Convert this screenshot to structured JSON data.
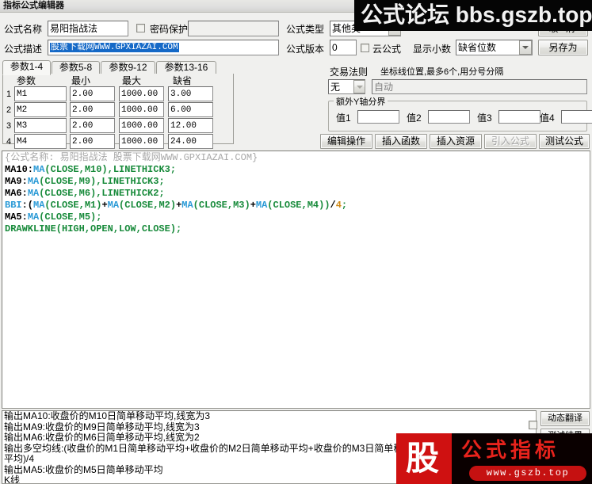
{
  "window": {
    "title": "指标公式编辑器"
  },
  "form": {
    "name_label": "公式名称",
    "name_value": "易阳指战法",
    "password_protect_label": "密码保护",
    "password_value": "",
    "desc_label": "公式描述",
    "desc_value": "股票下载网WWW.GPXIAZAI.COM",
    "type_label": "公式类型",
    "type_value": "其他类",
    "version_label": "公式版本",
    "version_value": "0",
    "cloud_label": "云公式",
    "decimal_label": "显示小数",
    "decimal_value": "缺省位数"
  },
  "buttons": {
    "cancel": "取 消",
    "save_as": "另存为",
    "edit_ops": "编辑操作",
    "insert_function": "插入函数",
    "insert_resource": "插入资源",
    "import_formula": "引入公式",
    "test_formula": "测试公式",
    "dynamic_translate": "动态翻译",
    "test_result": "测试结果"
  },
  "tabs": [
    {
      "label": "参数1-4",
      "active": true
    },
    {
      "label": "参数5-8",
      "active": false
    },
    {
      "label": "参数9-12",
      "active": false
    },
    {
      "label": "参数13-16",
      "active": false
    }
  ],
  "param_table": {
    "headers": [
      "参数",
      "最小",
      "最大",
      "缺省"
    ],
    "rows": [
      {
        "index": "1",
        "name": "M1",
        "min": "2.00",
        "max": "1000.00",
        "default": "3.00"
      },
      {
        "index": "2",
        "name": "M2",
        "min": "2.00",
        "max": "1000.00",
        "default": "6.00"
      },
      {
        "index": "3",
        "name": "M3",
        "min": "2.00",
        "max": "1000.00",
        "default": "12.00"
      },
      {
        "index": "4",
        "name": "M4",
        "min": "2.00",
        "max": "1000.00",
        "default": "24.00"
      }
    ]
  },
  "trade_rule": {
    "label": "交易法则",
    "value": "无",
    "axis_label": "坐标线位置,最多6个,用分号分隔",
    "axis_placeholder": "自动"
  },
  "extra_axis": {
    "caption": "额外Y轴分界",
    "fields": [
      {
        "label": "值1",
        "value": ""
      },
      {
        "label": "值2",
        "value": ""
      },
      {
        "label": "值3",
        "value": ""
      },
      {
        "label": "值4",
        "value": ""
      }
    ]
  },
  "code": {
    "lines": [
      "{公式名称: 易阳指战法 股票下载网WWW.GPXIAZAI.COM}",
      "MA10:MA(CLOSE,M10),LINETHICK3;",
      "MA9:MA(CLOSE,M9),LINETHICK3;",
      "MA6:MA(CLOSE,M6),LINETHICK2;",
      "BBI:(MA(CLOSE,M1)+MA(CLOSE,M2)+MA(CLOSE,M3)+MA(CLOSE,M4))/4;",
      "MA5:MA(CLOSE,M5);",
      "DRAWKLINE(HIGH,OPEN,LOW,CLOSE);"
    ]
  },
  "output": {
    "lines": [
      "输出MA10:收盘价的M10日简单移动平均,线宽为3",
      "输出MA9:收盘价的M9日简单移动平均,线宽为3",
      "输出MA6:收盘价的M6日简单移动平均,线宽为2",
      "输出多空均线:(收盘价的M1日简单移动平均+收盘价的M2日简单移动平均+收盘价的M3日简单移动",
      "平均)/4",
      "输出MA5:收盘价的M5日简单移动平均",
      "K线"
    ]
  },
  "watermarks": {
    "top_banner": "公式论坛 bbs.gszb.top",
    "bottom_left_char": "股",
    "bottom_title": "公式指标",
    "bottom_url": "www.gszb.top"
  },
  "colors": {
    "accent_selection": "#1569c7",
    "code_function": "#2a9ad6",
    "code_argument": "#178a3a",
    "code_number": "#d08a16",
    "watermark_red": "#cf1111"
  }
}
